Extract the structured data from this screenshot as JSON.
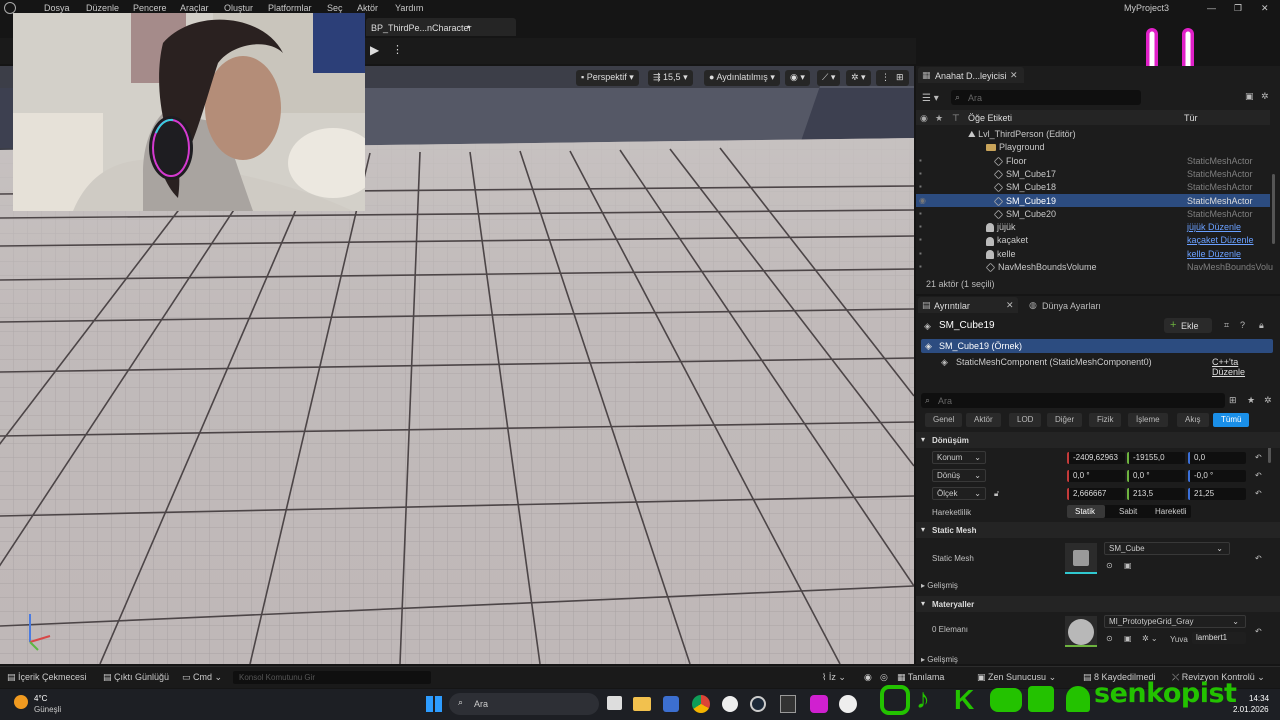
{
  "menu": {
    "items": [
      "Dosya",
      "Düzenle",
      "Pencere",
      "Araçlar",
      "Oluştur",
      "Platformlar",
      "Seç",
      "Aktör",
      "Yardım"
    ],
    "project": "MyProject3"
  },
  "tab": {
    "label": "BP_ThirdPe...nCharacter",
    "modified": "•"
  },
  "viewport": {
    "perspective": "Perspektif",
    "speed": "15,5",
    "lit": "Aydınlatılmış"
  },
  "outliner": {
    "tab": "Anahat D...leyicisi",
    "search_placeholder": "Ara",
    "col_label": "Öğe Etiketi",
    "col_type": "Tür",
    "rows": [
      {
        "name": "Lvl_ThirdPerson (Editör)",
        "type": "",
        "kind": "level"
      },
      {
        "name": "Playground",
        "type": "",
        "kind": "folder"
      },
      {
        "name": "Floor",
        "type": "StaticMeshActor",
        "kind": "mesh"
      },
      {
        "name": "SM_Cube17",
        "type": "StaticMeshActor",
        "kind": "mesh"
      },
      {
        "name": "SM_Cube18",
        "type": "StaticMeshActor",
        "kind": "mesh"
      },
      {
        "name": "SM_Cube19",
        "type": "StaticMeshActor",
        "kind": "mesh",
        "selected": true
      },
      {
        "name": "SM_Cube20",
        "type": "StaticMeshActor",
        "kind": "mesh"
      },
      {
        "name": "jüjük",
        "type": "jüjük Düzenle",
        "kind": "pawn",
        "link": true
      },
      {
        "name": "kaçaket",
        "type": "kaçaket Düzenle",
        "kind": "pawn",
        "link": true
      },
      {
        "name": "kelle",
        "type": "kelle Düzenle",
        "kind": "pawn",
        "link": true
      },
      {
        "name": "NavMeshBoundsVolume",
        "type": "NavMeshBoundsVolu",
        "kind": "volume"
      }
    ],
    "status": "21 aktör (1 seçili)"
  },
  "details": {
    "tab": "Ayrıntılar",
    "tab2": "Dünya Ayarları",
    "actor": "SM_Cube19",
    "add": "Ekle",
    "instance": "SM_Cube19 (Örnek)",
    "component": "StaticMeshComponent (StaticMeshComponent0)",
    "cpp_link": "C++'ta Düzenle",
    "search_placeholder": "Ara",
    "filters": [
      "Genel",
      "Aktör",
      "LOD",
      "Diğer",
      "Fizik",
      "İşleme",
      "Akış",
      "Tümü"
    ],
    "transform_header": "Dönüşüm",
    "location": {
      "label": "Konum",
      "x": "-2409,62963",
      "y": "-19155,0",
      "z": "0,0"
    },
    "rotation": {
      "label": "Dönüş",
      "x": "0,0 °",
      "y": "0,0 °",
      "z": "-0,0 °"
    },
    "scale": {
      "label": "Ölçek",
      "x": "2,666667",
      "y": "213,5",
      "z": "21,25"
    },
    "mobility": {
      "label": "Hareketlilik",
      "options": [
        "Statik",
        "Sabit",
        "Hareketli"
      ]
    },
    "static_mesh_header": "Static Mesh",
    "static_mesh_label": "Static Mesh",
    "static_mesh_value": "SM_Cube",
    "advanced": "Gelişmiş",
    "materials_header": "Materyaller",
    "element0": "0 Elemanı",
    "material_value": "MI_PrototypeGrid_Gray",
    "slot_label": "Yuva",
    "slot_value": "lambert1",
    "advanced2": "Gelişmiş"
  },
  "statusbar": {
    "content": "İçerik Çekmecesi",
    "log": "Çıktı Günlüğü",
    "cmd": "Cmd",
    "console_placeholder": "Konsol Komutunu Gir",
    "trace": "Tanılama",
    "zen": "Zen Sunucusu",
    "saved": "8 Kaydedilmedi",
    "revision": "Revizyon Kontrolü"
  },
  "taskbar": {
    "weather_temp": "4°C",
    "weather_desc": "Güneşli",
    "search": "Ara",
    "time": "14:34",
    "date": "2.01.2026"
  },
  "overlay": {
    "brand": "senkopist",
    "accent": "#23c200",
    "smile": "#e020c8"
  }
}
